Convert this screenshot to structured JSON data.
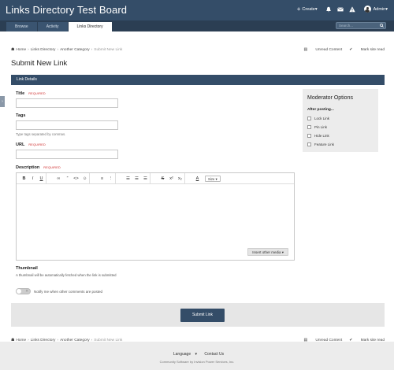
{
  "header": {
    "title": "Links Directory Test Board",
    "create_label": "Create",
    "user_name": "Admin"
  },
  "nav": {
    "tabs": [
      {
        "label": "Browse"
      },
      {
        "label": "Activity"
      },
      {
        "label": "Links Directory"
      }
    ],
    "search_placeholder": "Search..."
  },
  "breadcrumb": {
    "items": [
      "Home",
      "Links Directory",
      "Another Category"
    ],
    "current": "Submit New Link",
    "unread_label": "Unread Content",
    "mark_read_label": "Mark site read"
  },
  "page": {
    "title": "Submit New Link",
    "section_label": "Link Details"
  },
  "form": {
    "title_label": "Title",
    "required_label": "REQUIRED",
    "tags_label": "Tags",
    "tags_hint": "Type tags separated by commas.",
    "url_label": "URL",
    "description_label": "Description",
    "size_label": "Size",
    "insert_media_label": "Insert other media",
    "thumbnail_label": "Thumbnail",
    "thumbnail_hint": "A thumbnail will be automatically fetched when the link is submitted",
    "notify_label": "Notify me when other comments are posted",
    "submit_label": "Submit Link"
  },
  "moderator": {
    "title": "Moderator Options",
    "subtitle": "After posting...",
    "options": [
      "Lock Link",
      "Pin Link",
      "Hide Link",
      "Feature Link"
    ]
  },
  "footer": {
    "language_label": "Language",
    "contact_label": "Contact Us",
    "copyright": "Community Software by Invision Power Services, Inc."
  },
  "colors": {
    "header_bg": "#344d68",
    "nav_bg": "#2b3e53",
    "required": "#cc2222"
  }
}
